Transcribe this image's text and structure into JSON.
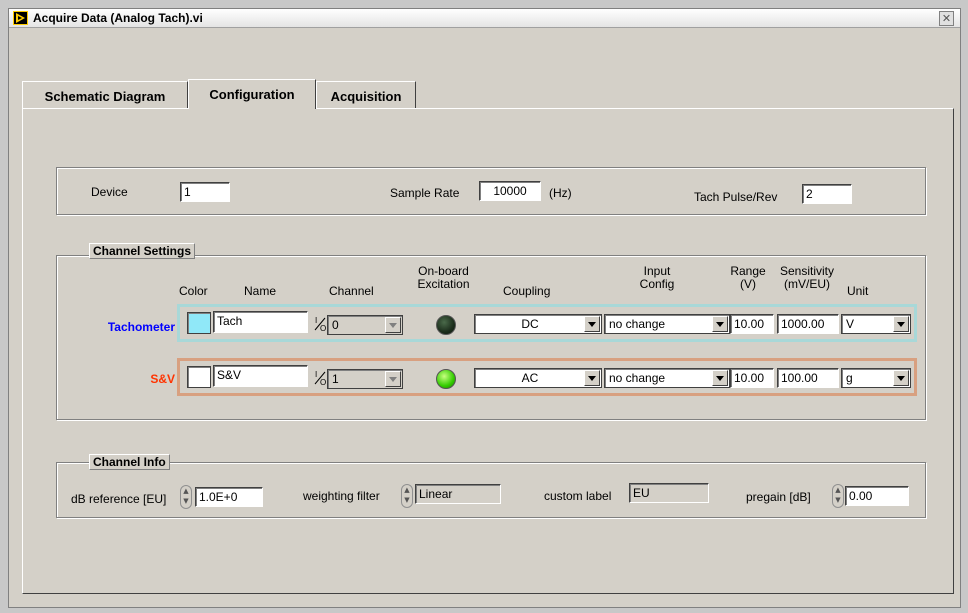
{
  "window": {
    "title": "Acquire Data (Analog Tach).vi",
    "close_glyph": "✕"
  },
  "tabs": [
    {
      "label": "Schematic Diagram"
    },
    {
      "label": "Configuration"
    },
    {
      "label": "Acquisition"
    }
  ],
  "top": {
    "device_label": "Device",
    "device_value": "1",
    "rate_label": "Sample Rate",
    "rate_value": "10000",
    "rate_unit": "(Hz)",
    "tach_label": "Tach Pulse/Rev",
    "tach_value": "2"
  },
  "channel_settings": {
    "title": "Channel Settings",
    "headers": {
      "color": "Color",
      "name": "Name",
      "channel": "Channel",
      "excitation_1": "On-board",
      "excitation_2": "Excitation",
      "coupling": "Coupling",
      "input_1": "Input",
      "input_2": "Config",
      "range_1": "Range",
      "range_2": "(V)",
      "sens_1": "Sensitivity",
      "sens_2": "(mV/EU)",
      "unit": "Unit"
    },
    "rows": [
      {
        "label": "Tachometer",
        "label_color": "#0000ff",
        "frame_color": "#a8d8d8",
        "swatch_color": "#90e8f8",
        "name": "Tach",
        "channel_icon": "I/O",
        "channel": "0",
        "excitation": "off",
        "coupling": "DC",
        "input_config": "no change",
        "range": "10.00",
        "sensitivity": "1000.00",
        "unit": "V"
      },
      {
        "label": "S&V",
        "label_color": "#ff3300",
        "frame_color": "#d8a080",
        "swatch_color": "#ffffff",
        "name": "S&V",
        "channel_icon": "I/O",
        "channel": "1",
        "excitation": "on",
        "coupling": "AC",
        "input_config": "no change",
        "range": "10.00",
        "sensitivity": "100.00",
        "unit": "g"
      }
    ]
  },
  "channel_info": {
    "title": "Channel Info",
    "db_ref_label": "dB reference [EU]",
    "db_ref_value": "1.0E+0",
    "weighting_label": "weighting filter",
    "weighting_value": "Linear",
    "custom_label_label": "custom label",
    "custom_label_value": "EU",
    "pregain_label": "pregain [dB]",
    "pregain_value": "0.00"
  }
}
